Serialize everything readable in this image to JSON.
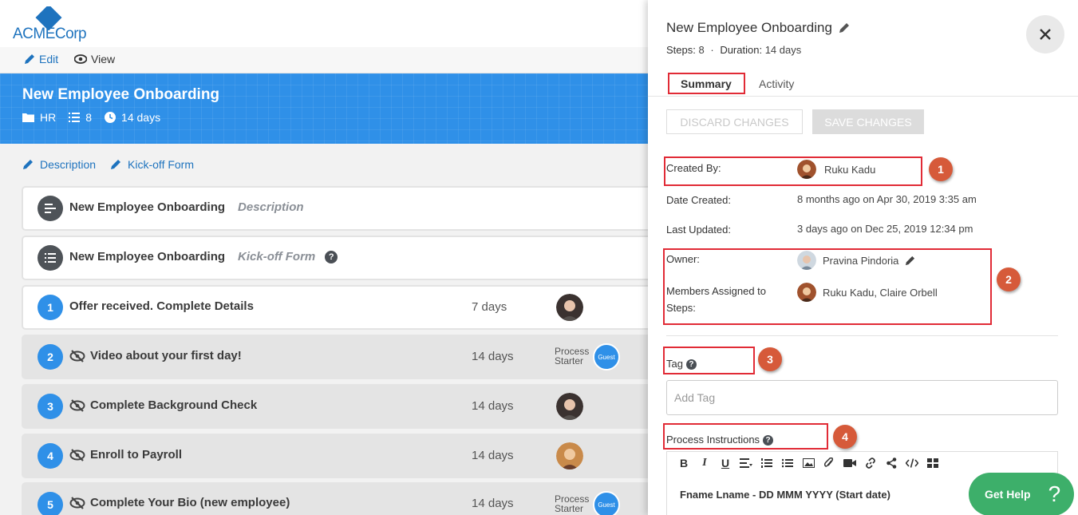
{
  "brand": {
    "name_left": "ACME",
    "name_right": "Corp",
    "color": "#1e73be"
  },
  "subnav": {
    "edit": "Edit",
    "view": "View"
  },
  "banner": {
    "title": "New Employee Onboarding",
    "folder": "HR",
    "steps": "8",
    "duration": "14 days",
    "color": "#2f90e8"
  },
  "links": {
    "description": "Description",
    "kickoff": "Kick-off Form"
  },
  "rows": [
    {
      "num": "",
      "name": "New Employee Onboarding",
      "sub": "Description",
      "duration": "",
      "hidden": false
    },
    {
      "num": "",
      "name": "New Employee Onboarding",
      "sub": "Kick-off Form",
      "duration": "",
      "hidden": false
    },
    {
      "num": "1",
      "name": "Offer received. Complete Details",
      "sub": "",
      "duration": "7 days",
      "hidden": false
    },
    {
      "num": "2",
      "name": "Video about your first day!",
      "sub": "",
      "duration": "14 days",
      "hidden": true,
      "process_starter": "Process Starter",
      "guest": "Guest"
    },
    {
      "num": "3",
      "name": "Complete Background Check",
      "sub": "",
      "duration": "14 days",
      "hidden": true
    },
    {
      "num": "4",
      "name": "Enroll to Payroll",
      "sub": "",
      "duration": "14 days",
      "hidden": true
    },
    {
      "num": "5",
      "name": "Complete Your Bio (new employee)",
      "sub": "",
      "duration": "14 days",
      "hidden": true,
      "process_starter": "Process Starter",
      "guest": "Guest"
    }
  ],
  "panel": {
    "title": "New Employee Onboarding",
    "steps_label": "Steps:",
    "steps_value": "8",
    "separator": "·",
    "duration_label": "Duration:",
    "duration_value": "14 days",
    "tabs": {
      "summary": "Summary",
      "activity": "Activity"
    },
    "discard": "DISCARD CHANGES",
    "save": "SAVE CHANGES",
    "created_by_label": "Created By:",
    "created_by_value": "Ruku Kadu",
    "date_created_label": "Date Created:",
    "date_created_value": "8 months ago on Apr 30, 2019 3:35 am",
    "last_updated_label": "Last Updated:",
    "last_updated_value": "3 days ago on Dec 25, 2019 12:34 pm",
    "owner_label": "Owner:",
    "owner_value": "Pravina Pindoria",
    "members_label": "Members Assigned to Steps:",
    "members_value": "Ruku Kadu, Claire Orbell",
    "tag_label": "Tag",
    "tag_placeholder": "Add Tag",
    "instructions_label": "Process Instructions",
    "editor_line": "Fname Lname - DD MMM YYYY (Start date)",
    "help_glyph": "?"
  },
  "callouts": [
    "1",
    "2",
    "3",
    "4"
  ],
  "gethelp": {
    "label": "Get Help",
    "icon": "?"
  }
}
